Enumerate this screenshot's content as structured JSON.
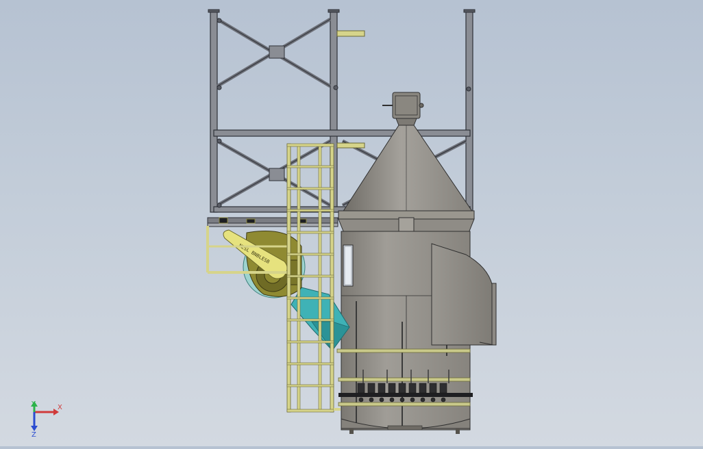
{
  "viewport": {
    "background_top": "#b6c2d2",
    "background_bottom": "#d3d9e1"
  },
  "model": {
    "fan_label": "NESL BNBLESB",
    "colors": {
      "steel_frame": "#3c3f46",
      "ladder_yellow": "#d8d88a",
      "vessel_grey": "#8f8c86",
      "fan_olive": "#8f8a32",
      "duct_cyan": "#3fb2b6",
      "ring_yellow": "#c9c98a"
    }
  },
  "triad": {
    "x_label": "X",
    "y_label": "Y",
    "z_label": "Z",
    "x_color": "#d03a3a",
    "y_color": "#2bb34a",
    "z_color": "#2a4bd0"
  }
}
